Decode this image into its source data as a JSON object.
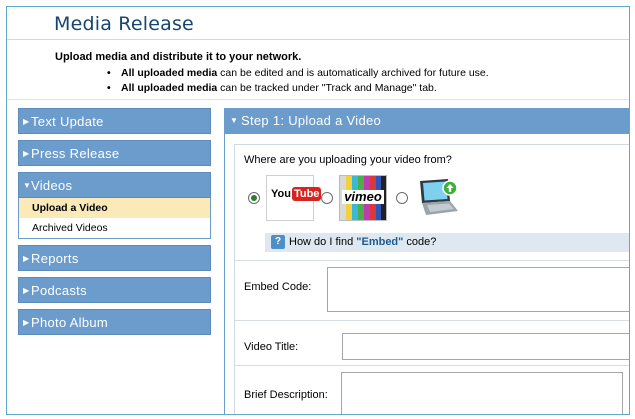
{
  "page": {
    "title": "Media Release"
  },
  "intro": {
    "text": "Upload media and distribute it to your network.",
    "bullets": [
      {
        "bold": "All uploaded media",
        "rest": " can be edited and is automatically archived for future use."
      },
      {
        "bold": "All uploaded media",
        "rest": " can be tracked under \"Track and Manage\" tab."
      }
    ]
  },
  "sidebar": {
    "items": [
      {
        "label": "Text Update"
      },
      {
        "label": "Press Release"
      },
      {
        "label": "Videos",
        "expanded": true,
        "sub": [
          "Upload a Video",
          "Archived Videos"
        ]
      },
      {
        "label": "Reports"
      },
      {
        "label": "Podcasts"
      },
      {
        "label": "Photo Album"
      }
    ]
  },
  "step": {
    "title": "Step 1: Upload a Video",
    "question": "Where are you uploading your video from?",
    "sources": [
      {
        "name": "youtube-logo",
        "you": "You",
        "tube": "Tube",
        "selected": true
      },
      {
        "name": "vimeo-logo",
        "text": "vimeo",
        "selected": false
      },
      {
        "name": "computer-upload-icon",
        "selected": false
      }
    ],
    "help": {
      "prefix": "How do I find ",
      "highlight": "\"Embed\"",
      "suffix": " code?"
    },
    "fields": {
      "embed_label": "Embed Code:",
      "title_label": "Video Title:",
      "desc_label": "Brief Description:"
    }
  },
  "colors": {
    "accent": "#6b9ccb",
    "title": "#16456f",
    "active_item": "#fbe9b7"
  }
}
